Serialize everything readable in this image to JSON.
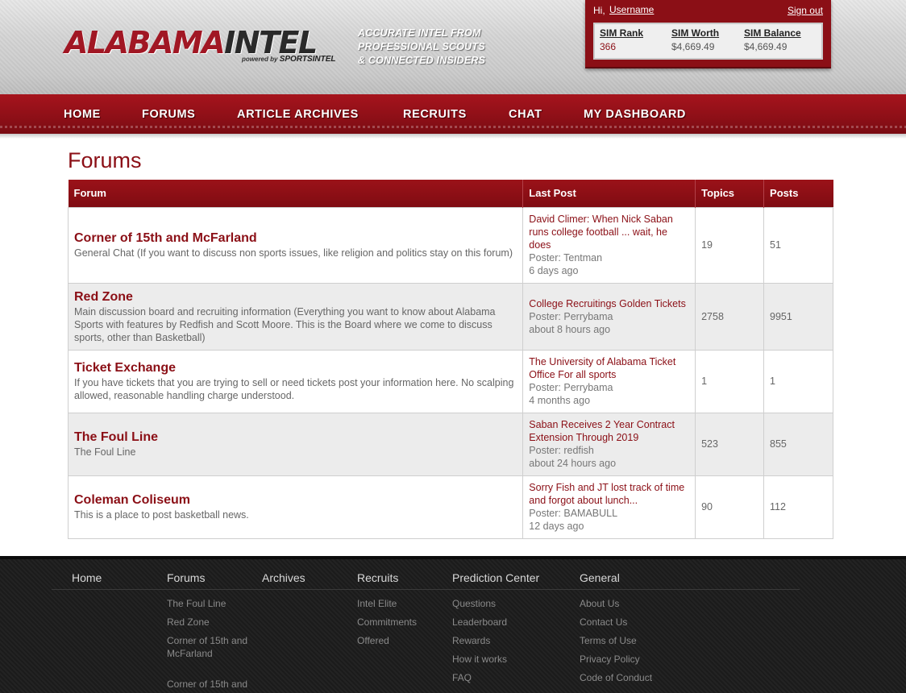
{
  "header": {
    "logo_main_a": "ALABAMA",
    "logo_main_b": "INTEL",
    "logo_powered": "powered by",
    "logo_brand": "SPORTSINTEL",
    "tagline": [
      "ACCURATE INTEL FROM",
      "PROFESSIONAL SCOUTS",
      "& CONNECTED INSIDERS"
    ]
  },
  "sim": {
    "greeting": "Hi,",
    "username": "Username",
    "signout": "Sign out",
    "rank_label": "SIM Rank",
    "rank_value": "366",
    "worth_label": "SIM Worth",
    "worth_value": "$4,669.49",
    "balance_label": "SIM Balance",
    "balance_value": "$4,669.49"
  },
  "nav": [
    "HOME",
    "FORUMS",
    "ARTICLE ARCHIVES",
    "RECRUITS",
    "CHAT",
    "MY DASHBOARD"
  ],
  "page_title": "Forums",
  "table": {
    "headers": [
      "Forum",
      "Last Post",
      "Topics",
      "Posts"
    ],
    "rows": [
      {
        "name": "Corner of 15th and McFarland",
        "desc": "General Chat (If you want to discuss non sports issues, like religion and politics stay on this forum)",
        "last_title": "David Climer: When Nick Saban runs college football ... wait, he does",
        "poster": "Poster: Tentman",
        "ago": "6 days ago",
        "topics": "19",
        "posts": "51"
      },
      {
        "name": "Red Zone",
        "desc": "Main discussion board and recruiting information (Everything you want to know about Alabama Sports with features by Redfish and Scott Moore. This is the Board where we come to discuss sports, other than Basketball)",
        "last_title": "College Recruitings Golden Tickets",
        "poster": "Poster: Perrybama",
        "ago": "about 8 hours ago",
        "topics": "2758",
        "posts": "9951"
      },
      {
        "name": "Ticket Exchange",
        "desc": "If you have tickets that you are trying to sell or need tickets post your information here. No scalping allowed, reasonable handling charge understood.",
        "last_title": "The University of Alabama Ticket Office For all sports",
        "poster": "Poster: Perrybama",
        "ago": "4 months ago",
        "topics": "1",
        "posts": "1"
      },
      {
        "name": "The Foul Line",
        "desc": "The Foul Line",
        "last_title": "Saban Receives 2 Year Contract Extension Through 2019",
        "poster": "Poster: redfish",
        "ago": "about 24 hours ago",
        "topics": "523",
        "posts": "855"
      },
      {
        "name": "Coleman Coliseum",
        "desc": "This is a place to post basketball news.",
        "last_title": "Sorry Fish and JT lost track of time and forgot about lunch...",
        "poster": "Poster: BAMABULL",
        "ago": "12 days ago",
        "topics": "90",
        "posts": "112"
      }
    ]
  },
  "footer": {
    "home": "Home",
    "forums": {
      "title": "Forums",
      "links": [
        "The Foul Line",
        "Red Zone",
        "Corner of 15th and McFarland",
        "Corner of 15th and"
      ]
    },
    "archives": "Archives",
    "recruits": {
      "title": "Recruits",
      "links": [
        "Intel Elite",
        "Commitments",
        "Offered"
      ]
    },
    "prediction": {
      "title": "Prediction Center",
      "links": [
        "Questions",
        "Leaderboard",
        "Rewards",
        "How it works",
        "FAQ"
      ]
    },
    "general": {
      "title": "General",
      "links": [
        "About Us",
        "Contact Us",
        "Terms of Use",
        "Privacy Policy",
        "Code of Conduct"
      ]
    }
  }
}
